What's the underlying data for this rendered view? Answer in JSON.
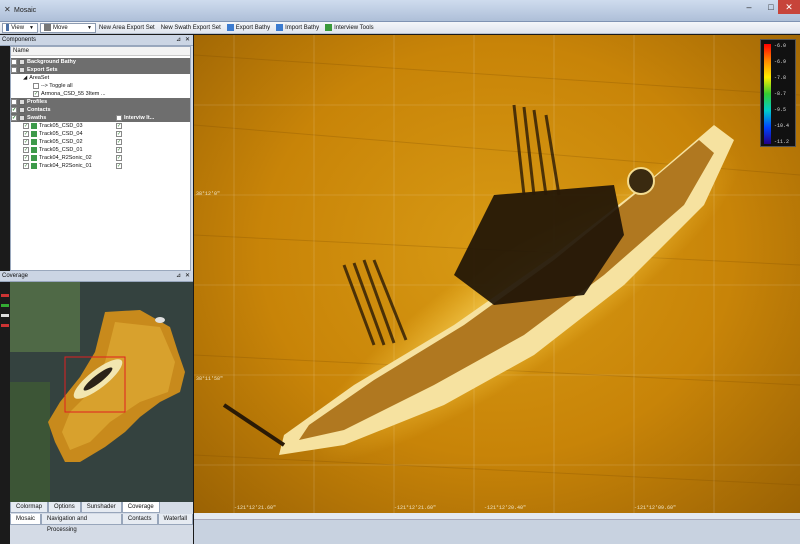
{
  "window": {
    "title": "Mosaic"
  },
  "toolbar": {
    "view_label": "View",
    "mode_label": "Move",
    "new_area_export_set": "New Area Export Set",
    "new_swath_export_set": "New Swath Export Set",
    "export_bathy": "Export Bathy",
    "import_bathy": "Import Bathy",
    "interview_tools": "Interview Tools"
  },
  "components": {
    "title": "Components",
    "column": "Name",
    "background_bathy": "Background Bathy",
    "export_sets": "Export Sets",
    "areaset": "AreaSet",
    "toggle_all": "--> Toggle all",
    "areaset_item": "Armona_CSD_55 3Item ...",
    "profiles": "Profiles",
    "contacts": "Contacts",
    "swaths": "Swaths",
    "interview_col": "Interviw It...",
    "swath_items": [
      "Track05_CSD_03",
      "Track05_CSD_04",
      "Track05_CSD_02",
      "Track05_CSD_01",
      "Track04_R2Sonic_02",
      "Track04_R2Sonic_01"
    ]
  },
  "coverage": {
    "title": "Coverage",
    "tabs": [
      "Colormap",
      "Options",
      "Sunshader",
      "Coverage"
    ],
    "active_tab": "Coverage",
    "bottom_tabs": [
      "Mosaic",
      "Navigation and Processing",
      "Contacts",
      "Waterfall"
    ],
    "active_bottom_tab": "Mosaic"
  },
  "legend": {
    "labels": [
      "-6.0",
      "-6.9",
      "-7.8",
      "-8.7",
      "-9.5",
      "-10.4",
      "-11.2"
    ]
  },
  "colors": {
    "map_base": "#c88408",
    "group_row": "#6e6e6e",
    "swath_icon": "#3d9a4a"
  }
}
